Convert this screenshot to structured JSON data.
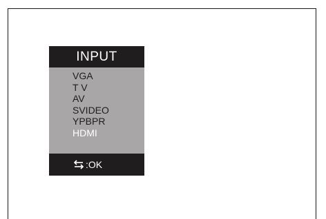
{
  "osd_menu": {
    "title": "INPUT",
    "items": [
      {
        "label": "VGA",
        "selected": false
      },
      {
        "label": "T V",
        "selected": false
      },
      {
        "label": "AV",
        "selected": false
      },
      {
        "label": "SVIDEO",
        "selected": false
      },
      {
        "label": "YPBPR",
        "selected": false
      },
      {
        "label": "HDMI",
        "selected": true
      }
    ],
    "footer": {
      "icon": "swap-arrows-icon",
      "label": ":OK"
    },
    "colors": {
      "header_bg": "#1f1d1e",
      "list_bg": "#a9a6a7",
      "selected_text": "#ffffff",
      "item_text": "#1f1d1e"
    }
  }
}
